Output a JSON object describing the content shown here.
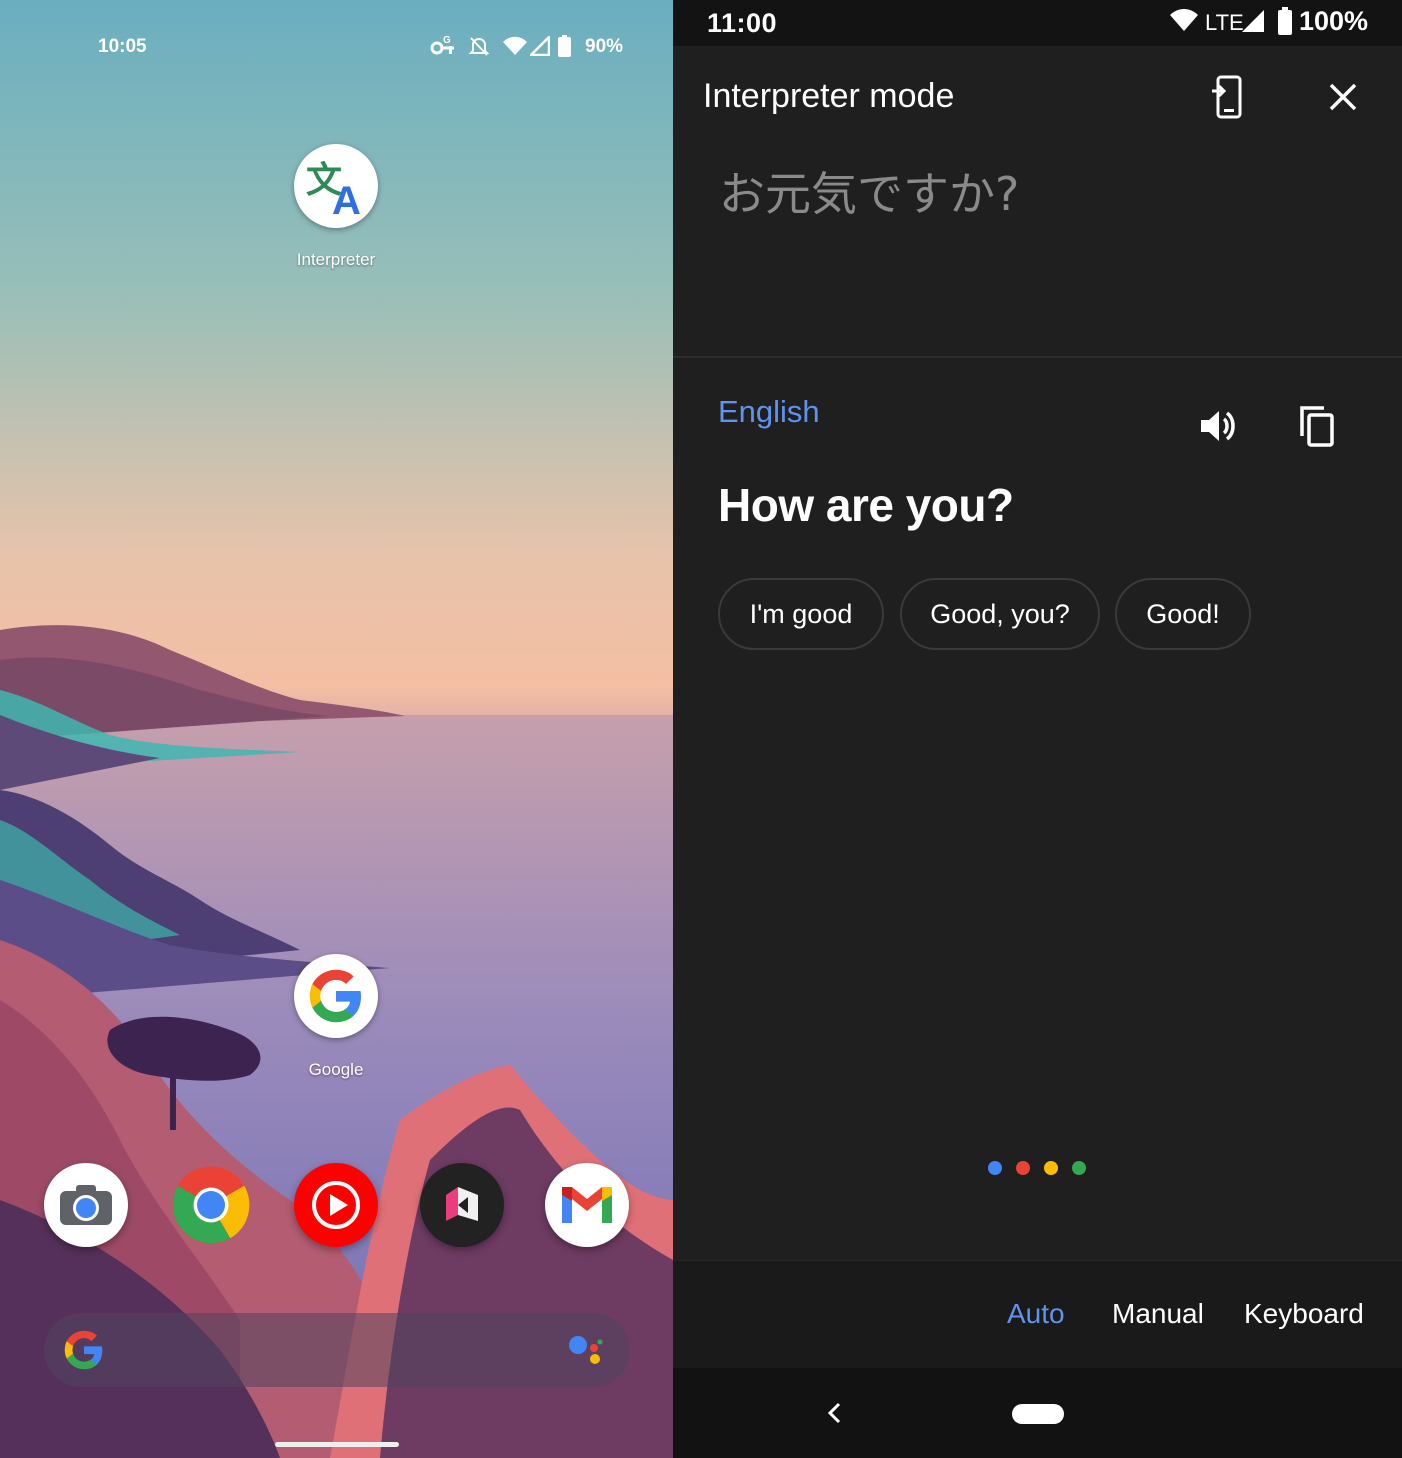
{
  "left_screen": {
    "status_bar": {
      "time": "10:05",
      "battery": "90%"
    },
    "apps": [
      {
        "label": "Interpreter",
        "icon": "translate-icon"
      },
      {
        "label": "Google",
        "icon": "google-g-icon"
      }
    ],
    "dock": [
      "camera-icon",
      "chrome-icon",
      "youtube-music-icon",
      "pixel-tips-icon",
      "gmail-icon"
    ],
    "search_bar": {
      "left_icon": "google-g-icon",
      "right_icon": "assistant-icon"
    }
  },
  "right_screen": {
    "status_bar": {
      "time": "11:00",
      "network": "LTE",
      "battery": "100%"
    },
    "header": {
      "title": "Interpreter mode"
    },
    "source_text": "お元気ですか?",
    "target_language": "English",
    "translation": "How are you?",
    "suggestions": [
      "I'm good",
      "Good, you?",
      "Good!"
    ],
    "listening_dots": [
      "#4285f4",
      "#ea4335",
      "#fbbc05",
      "#34a853"
    ],
    "modes": {
      "active": "Auto",
      "items": [
        "Auto",
        "Manual",
        "Keyboard"
      ]
    },
    "colors": {
      "accent": "#5f93ee",
      "background": "#1f1f1f"
    }
  }
}
